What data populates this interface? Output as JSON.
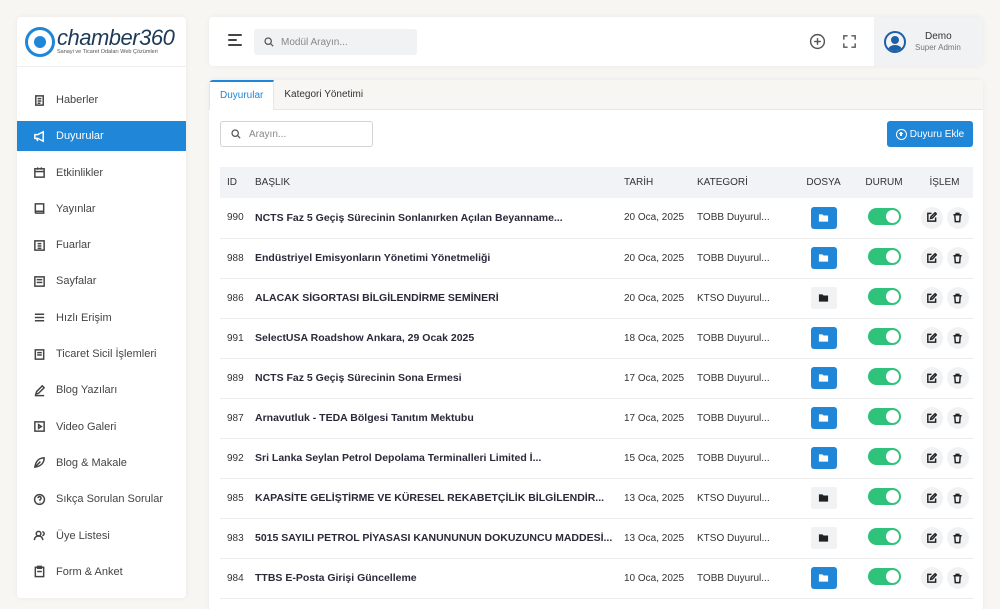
{
  "brand": {
    "name": "chamber360",
    "tagline": "Sanayi ve Ticaret Odaları Web Çözümleri",
    "accent": "#1f86d8"
  },
  "sidebar": {
    "items": [
      {
        "label": "Haberler",
        "icon": "newspaper-icon",
        "active": false
      },
      {
        "label": "Duyurular",
        "icon": "megaphone-icon",
        "active": true
      },
      {
        "label": "Etkinlikler",
        "icon": "calendar-icon",
        "active": false
      },
      {
        "label": "Yayınlar",
        "icon": "book-icon",
        "active": false
      },
      {
        "label": "Fuarlar",
        "icon": "building-icon",
        "active": false
      },
      {
        "label": "Sayfalar",
        "icon": "page-icon",
        "active": false
      },
      {
        "label": "Hızlı Erişim",
        "icon": "list-icon",
        "active": false
      },
      {
        "label": "Ticaret Sicil İşlemleri",
        "icon": "document-icon",
        "active": false
      },
      {
        "label": "Blog Yazıları",
        "icon": "pen-icon",
        "active": false
      },
      {
        "label": "Video Galeri",
        "icon": "video-icon",
        "active": false
      },
      {
        "label": "Blog & Makale",
        "icon": "leaf-icon",
        "active": false
      },
      {
        "label": "Sıkça Sorulan Sorular",
        "icon": "question-icon",
        "active": false
      },
      {
        "label": "Üye Listesi",
        "icon": "users-icon",
        "active": false
      },
      {
        "label": "Form & Anket",
        "icon": "clipboard-icon",
        "active": false
      }
    ]
  },
  "header": {
    "search_placeholder": "Modül Arayın...",
    "user": {
      "name": "Demo",
      "role": "Super Admin"
    }
  },
  "tabs": [
    {
      "label": "Duyurular",
      "active": true
    },
    {
      "label": "Kategori Yönetimi",
      "active": false
    }
  ],
  "toolbar": {
    "search_placeholder": "Arayın...",
    "add_label": "Duyuru Ekle"
  },
  "table": {
    "columns": [
      "ID",
      "BAŞLIK",
      "TARİH",
      "KATEGORİ",
      "DOSYA",
      "DURUM",
      "İŞLEM"
    ],
    "rows": [
      {
        "id": "990",
        "title": "NCTS Faz 5 Geçiş Sürecinin Sonlanırken Açılan Beyanname...",
        "date": "20 Oca, 2025",
        "category": "TOBB Duyurul...",
        "has_file": true,
        "active": true
      },
      {
        "id": "988",
        "title": "Endüstriyel Emisyonların Yönetimi Yönetmeliği",
        "date": "20 Oca, 2025",
        "category": "TOBB Duyurul...",
        "has_file": true,
        "active": true
      },
      {
        "id": "986",
        "title": "ALACAK SİGORTASI BİLGİLENDİRME SEMİNERİ",
        "date": "20 Oca, 2025",
        "category": "KTSO Duyurul...",
        "has_file": false,
        "active": true
      },
      {
        "id": "991",
        "title": "SelectUSA Roadshow Ankara, 29 Ocak 2025",
        "date": "18 Oca, 2025",
        "category": "TOBB Duyurul...",
        "has_file": true,
        "active": true
      },
      {
        "id": "989",
        "title": "NCTS Faz 5 Geçiş Sürecinin Sona Ermesi",
        "date": "17 Oca, 2025",
        "category": "TOBB Duyurul...",
        "has_file": true,
        "active": true
      },
      {
        "id": "987",
        "title": "Arnavutluk - TEDA Bölgesi Tanıtım Mektubu",
        "date": "17 Oca, 2025",
        "category": "TOBB Duyurul...",
        "has_file": true,
        "active": true
      },
      {
        "id": "992",
        "title": "Sri Lanka Seylan Petrol Depolama Terminalleri Limited İ...",
        "date": "15 Oca, 2025",
        "category": "TOBB Duyurul...",
        "has_file": true,
        "active": true
      },
      {
        "id": "985",
        "title": "KAPASİTE GELİŞTİRME VE KÜRESEL REKABETÇİLİK BİLGİLENDİR...",
        "date": "13 Oca, 2025",
        "category": "KTSO Duyurul...",
        "has_file": false,
        "active": true
      },
      {
        "id": "983",
        "title": "5015 SAYILI PETROL PİYASASI KANUNUNUN DOKUZUNCU MADDESİ...",
        "date": "13 Oca, 2025",
        "category": "KTSO Duyurul...",
        "has_file": false,
        "active": true
      },
      {
        "id": "984",
        "title": "TTBS E-Posta Girişi Güncelleme",
        "date": "10 Oca, 2025",
        "category": "TOBB Duyurul...",
        "has_file": true,
        "active": true
      }
    ]
  }
}
